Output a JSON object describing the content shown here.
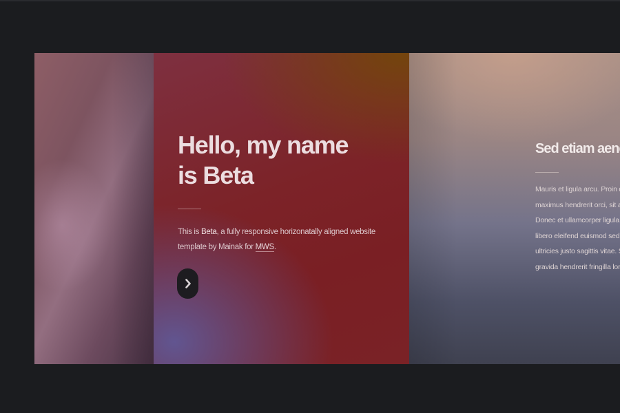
{
  "hero": {
    "title_line_1": "Hello, my name",
    "title_line_2": "is Beta",
    "text_intro": "This is ",
    "text_brand": "Beta",
    "text_middle": ", a fully responsive horizonatally aligned website template by Mainak for ",
    "text_link": "MWS",
    "text_end": ".",
    "next_icon": "chevron-right-icon"
  },
  "section": {
    "title": "Sed etiam aenea",
    "lines": [
      "Mauris et ligula arcu. Proin dap",
      "maximus hendrerit orci, sit ame",
      "Donec et ullamcorper ligula. Su",
      "libero eleifend euismod sed tris",
      "ultricies justo sagittis vitae. Sed",
      "gravida hendrerit fringilla lorem"
    ]
  },
  "colors": {
    "page_background": "#1b1c1f",
    "hero_accent_red": "#7c2328",
    "hero_accent_purple": "#605896",
    "button_background": "#1d1c20"
  }
}
